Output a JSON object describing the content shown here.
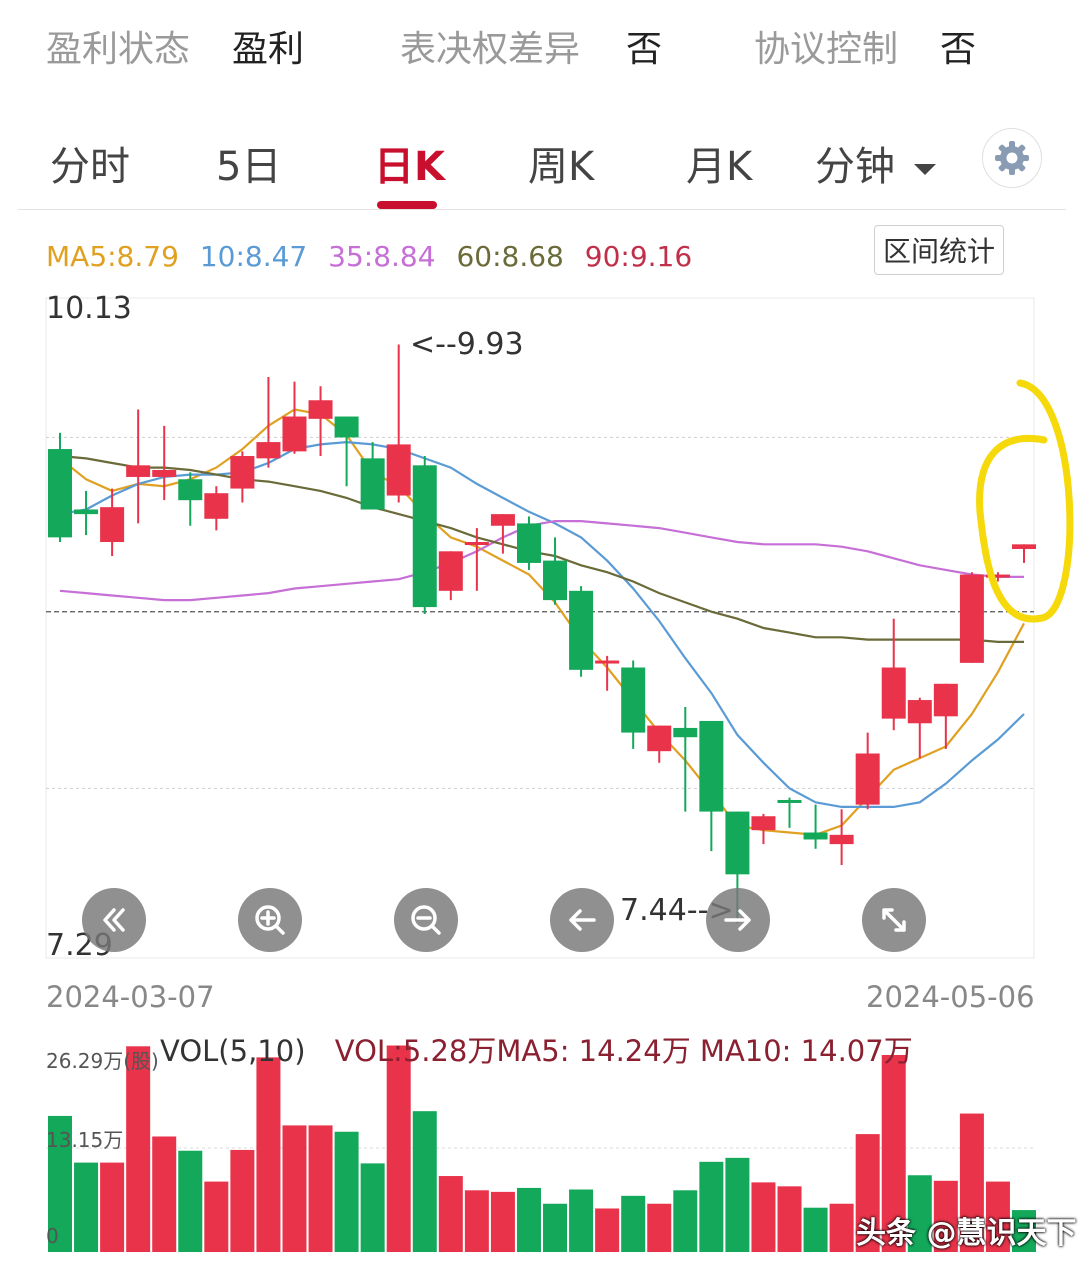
{
  "info": {
    "profit_status_label": "盈利状态",
    "profit_status_value": "盈利",
    "voting_diff_label": "表决权差异",
    "voting_diff_value": "否",
    "agreement_control_label": "协议控制",
    "agreement_control_value": "否"
  },
  "tabs": [
    {
      "label": "分时",
      "active": false
    },
    {
      "label": "5日",
      "active": false
    },
    {
      "label": "日K",
      "active": true
    },
    {
      "label": "周K",
      "active": false
    },
    {
      "label": "月K",
      "active": false
    },
    {
      "label": "分钟",
      "active": false
    }
  ],
  "settings_icon": "gear-icon",
  "range_stats_label": "区间统计",
  "ma_legend": {
    "ma5": "MA5:8.79",
    "ma10": "10:8.47",
    "ma35": "35:8.84",
    "ma60": "60:8.68",
    "ma90": "90:9.16",
    "colors": {
      "ma5": "#e0a020",
      "ma10": "#5b9bd5",
      "ma35": "#c66fd6",
      "ma60": "#6b6b3a",
      "ma90": "#c0304a"
    }
  },
  "chart": {
    "price_max_label": "10.13",
    "price_min_label": "7.29",
    "high_annotation": "<--9.93",
    "low_annotation": "7.44-->",
    "start_date": "2024-03-07",
    "end_date": "2024-05-06"
  },
  "chart_data": {
    "type": "candlestick",
    "ylim": [
      7.29,
      10.13
    ],
    "up_color": "#e8334a",
    "down_color": "#13a85a",
    "candles": [
      {
        "o": 9.48,
        "h": 9.55,
        "l": 9.08,
        "c": 9.1
      },
      {
        "o": 9.22,
        "h": 9.3,
        "l": 9.11,
        "c": 9.2
      },
      {
        "o": 9.08,
        "h": 9.31,
        "l": 9.02,
        "c": 9.23
      },
      {
        "o": 9.36,
        "h": 9.65,
        "l": 9.16,
        "c": 9.41
      },
      {
        "o": 9.36,
        "h": 9.58,
        "l": 9.26,
        "c": 9.39
      },
      {
        "o": 9.35,
        "h": 9.38,
        "l": 9.15,
        "c": 9.26
      },
      {
        "o": 9.18,
        "h": 9.32,
        "l": 9.13,
        "c": 9.29
      },
      {
        "o": 9.31,
        "h": 9.47,
        "l": 9.25,
        "c": 9.45
      },
      {
        "o": 9.44,
        "h": 9.79,
        "l": 9.4,
        "c": 9.51
      },
      {
        "o": 9.47,
        "h": 9.77,
        "l": 9.46,
        "c": 9.62
      },
      {
        "o": 9.61,
        "h": 9.75,
        "l": 9.45,
        "c": 9.69
      },
      {
        "o": 9.62,
        "h": 9.58,
        "l": 9.32,
        "c": 9.53
      },
      {
        "o": 9.44,
        "h": 9.51,
        "l": 9.27,
        "c": 9.22
      },
      {
        "o": 9.28,
        "h": 9.93,
        "l": 9.25,
        "c": 9.5
      },
      {
        "o": 9.41,
        "h": 9.45,
        "l": 8.77,
        "c": 8.8
      },
      {
        "o": 8.87,
        "h": 9.04,
        "l": 8.83,
        "c": 9.04
      },
      {
        "o": 9.07,
        "h": 9.14,
        "l": 8.87,
        "c": 9.08
      },
      {
        "o": 9.15,
        "h": 9.2,
        "l": 9.03,
        "c": 9.2
      },
      {
        "o": 9.16,
        "h": 9.19,
        "l": 8.96,
        "c": 8.99
      },
      {
        "o": 9.0,
        "h": 9.1,
        "l": 8.81,
        "c": 8.83
      },
      {
        "o": 8.87,
        "h": 8.89,
        "l": 8.5,
        "c": 8.53
      },
      {
        "o": 8.57,
        "h": 8.59,
        "l": 8.44,
        "c": 8.57
      },
      {
        "o": 8.54,
        "h": 8.57,
        "l": 8.19,
        "c": 8.26
      },
      {
        "o": 8.18,
        "h": 8.29,
        "l": 8.13,
        "c": 8.29
      },
      {
        "o": 8.28,
        "h": 8.37,
        "l": 7.92,
        "c": 8.24
      },
      {
        "o": 8.31,
        "h": 8.31,
        "l": 7.75,
        "c": 7.92
      },
      {
        "o": 7.92,
        "h": 7.92,
        "l": 7.44,
        "c": 7.65
      },
      {
        "o": 7.84,
        "h": 7.91,
        "l": 7.78,
        "c": 7.9
      },
      {
        "o": 7.97,
        "h": 7.98,
        "l": 7.85,
        "c": 7.96
      },
      {
        "o": 7.83,
        "h": 7.95,
        "l": 7.76,
        "c": 7.8
      },
      {
        "o": 7.78,
        "h": 7.93,
        "l": 7.69,
        "c": 7.82
      },
      {
        "o": 7.95,
        "h": 8.26,
        "l": 7.93,
        "c": 8.17
      },
      {
        "o": 8.32,
        "h": 8.75,
        "l": 8.27,
        "c": 8.54
      },
      {
        "o": 8.3,
        "h": 8.41,
        "l": 8.15,
        "c": 8.4
      },
      {
        "o": 8.33,
        "h": 8.47,
        "l": 8.19,
        "c": 8.47
      },
      {
        "o": 8.56,
        "h": 8.95,
        "l": 8.56,
        "c": 8.94
      },
      {
        "o": 8.93,
        "h": 8.95,
        "l": 8.91,
        "c": 8.94
      },
      {
        "o": 9.05,
        "h": 9.07,
        "l": 8.99,
        "c": 9.07
      }
    ],
    "ma": {
      "ma5": [
        9.44,
        9.35,
        9.3,
        9.33,
        9.32,
        9.35,
        9.4,
        9.48,
        9.58,
        9.65,
        9.63,
        9.54,
        9.38,
        9.32,
        9.2,
        9.1,
        9.06,
        9.0,
        8.94,
        8.82,
        8.66,
        8.54,
        8.4,
        8.26,
        8.14,
        8.0,
        7.86,
        7.84,
        7.83,
        7.82,
        7.86,
        7.98,
        8.1,
        8.15,
        8.2,
        8.34,
        8.52,
        8.73
      ],
      "ma10": [
        9.2,
        9.22,
        9.28,
        9.33,
        9.36,
        9.37,
        9.37,
        9.38,
        9.42,
        9.48,
        9.5,
        9.51,
        9.5,
        9.48,
        9.44,
        9.4,
        9.33,
        9.27,
        9.21,
        9.16,
        9.1,
        9.0,
        8.88,
        8.74,
        8.58,
        8.43,
        8.25,
        8.13,
        8.02,
        7.96,
        7.94,
        7.94,
        7.94,
        7.96,
        8.04,
        8.14,
        8.23,
        8.34
      ],
      "ma35": [
        8.87,
        8.86,
        8.85,
        8.84,
        8.83,
        8.83,
        8.84,
        8.85,
        8.86,
        8.88,
        8.89,
        8.9,
        8.91,
        8.92,
        8.95,
        8.99,
        9.04,
        9.1,
        9.15,
        9.17,
        9.17,
        9.16,
        9.15,
        9.14,
        9.12,
        9.1,
        9.08,
        9.07,
        9.07,
        9.07,
        9.06,
        9.04,
        9.01,
        8.98,
        8.96,
        8.94,
        8.93,
        8.93
      ],
      "ma60": [
        9.45,
        9.44,
        9.42,
        9.4,
        9.4,
        9.39,
        9.37,
        9.35,
        9.34,
        9.32,
        9.3,
        9.27,
        9.23,
        9.2,
        9.17,
        9.14,
        9.1,
        9.07,
        9.04,
        9.02,
        8.98,
        8.95,
        8.91,
        8.86,
        8.82,
        8.78,
        8.75,
        8.71,
        8.69,
        8.67,
        8.67,
        8.66,
        8.66,
        8.66,
        8.66,
        8.66,
        8.65,
        8.65
      ]
    },
    "dashed_level": 8.78,
    "grid_levels": [
      9.53,
      8.02
    ],
    "volume": {
      "indicator_label": "VOL(5,10)",
      "current_label": "VOL:5.28万MA5: 14.24万 MA10: 14.07万",
      "max_tick_label": "26.29万(股)",
      "mid_tick_label": "13.15万",
      "zero_label": "0",
      "ylim": [
        0,
        26.29
      ],
      "values": [
        17.2,
        11.3,
        11.3,
        26.0,
        14.6,
        12.8,
        8.9,
        12.9,
        24.6,
        16.0,
        16.0,
        15.2,
        11.2,
        26.1,
        17.8,
        9.6,
        7.8,
        7.6,
        8.1,
        6.1,
        7.9,
        5.5,
        7.1,
        6.1,
        7.8,
        11.4,
        11.9,
        8.8,
        8.3,
        5.6,
        6.1,
        14.9,
        24.9,
        9.7,
        9.0,
        17.5,
        8.9,
        5.3
      ],
      "up": [
        false,
        false,
        true,
        true,
        true,
        false,
        true,
        true,
        true,
        true,
        true,
        false,
        false,
        true,
        false,
        true,
        true,
        true,
        false,
        false,
        false,
        true,
        false,
        true,
        false,
        false,
        false,
        true,
        true,
        false,
        true,
        true,
        true,
        false,
        true,
        true,
        true,
        false
      ]
    }
  },
  "watermark": "头条 @慧识天下",
  "controls": [
    "rewind-icon",
    "zoom-in-icon",
    "zoom-out-icon",
    "arrow-left-icon",
    "arrow-right-icon",
    "expand-icon"
  ]
}
